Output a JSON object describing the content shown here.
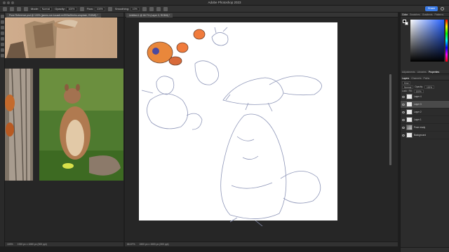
{
  "app": {
    "title": "Adobe Photoshop 2023"
  },
  "options_bar": {
    "mode_label": "Mode:",
    "mode_value": "Normal",
    "opacity_label": "Opacity:",
    "opacity_value": "100%",
    "flow_label": "Flow:",
    "flow_value": "100%",
    "smoothing_label": "Smoothing:",
    "smoothing_value": "10%",
    "share_label": "Share"
  },
  "documents": {
    "left_tab": "Pose Reference.psd @ 100% (james-roe-kouadi-m4903a26mhs-unsplash, RGB/8) *",
    "right_tab": "Untitled-1 @ 66.7% (Layer 3, RGB/8) *",
    "left_status": [
      "100%",
      "1920 px x 1080 px (300 ppi)"
    ],
    "right_status": [
      "66.67%",
      "1500 px x 1500 px (300 ppi)"
    ]
  },
  "panels": {
    "color_tabs": [
      "Color",
      "Swatches",
      "Gradients",
      "Patterns"
    ],
    "adjust_tabs": [
      "Adjustments",
      "Libraries",
      "Properties"
    ],
    "layer_tabs": [
      "Layers",
      "Channels",
      "Paths"
    ],
    "layer_controls": {
      "kind": "Kind",
      "blend": "Normal",
      "opacity_label": "Opacity:",
      "opacity_value": "100%",
      "lock_label": "Lock:",
      "fill_label": "Fill:",
      "fill_value": "100%"
    },
    "layers": [
      {
        "name": "Layer 4"
      },
      {
        "name": "Layer 3"
      },
      {
        "name": "Layer 2"
      },
      {
        "name": "Layer 1"
      },
      {
        "name": "Pose ready"
      },
      {
        "name": "Background"
      }
    ]
  }
}
